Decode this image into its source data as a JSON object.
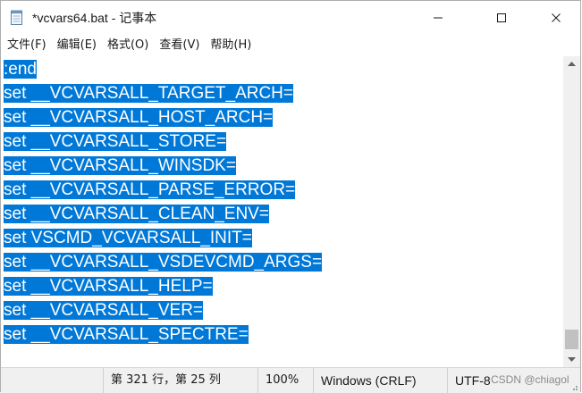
{
  "window": {
    "title": "*vcvars64.bat - 记事本",
    "icon": "notepad-icon"
  },
  "menu": [
    {
      "label": "文件(F)"
    },
    {
      "label": "编辑(E)"
    },
    {
      "label": "格式(O)"
    },
    {
      "label": "查看(V)"
    },
    {
      "label": "帮助(H)"
    }
  ],
  "editor": {
    "lines": [
      ":end",
      "set __VCVARSALL_TARGET_ARCH=",
      "set __VCVARSALL_HOST_ARCH=",
      "set __VCVARSALL_STORE=",
      "set __VCVARSALL_WINSDK=",
      "set __VCVARSALL_PARSE_ERROR=",
      "set __VCVARSALL_CLEAN_ENV=",
      "set VSCMD_VCVARSALL_INIT=",
      "set __VCVARSALL_VSDEVCMD_ARGS=",
      "set __VCVARSALL_HELP=",
      "set __VCVARSALL_VER=",
      "set __VCVARSALL_SPECTRE="
    ],
    "selection_color": "#0078d7"
  },
  "statusbar": {
    "position": "第 321 行，第 25 列",
    "zoom": "100%",
    "line_ending": "Windows (CRLF)",
    "encoding": "UTF-8",
    "watermark": "CSDN @chiagol"
  }
}
